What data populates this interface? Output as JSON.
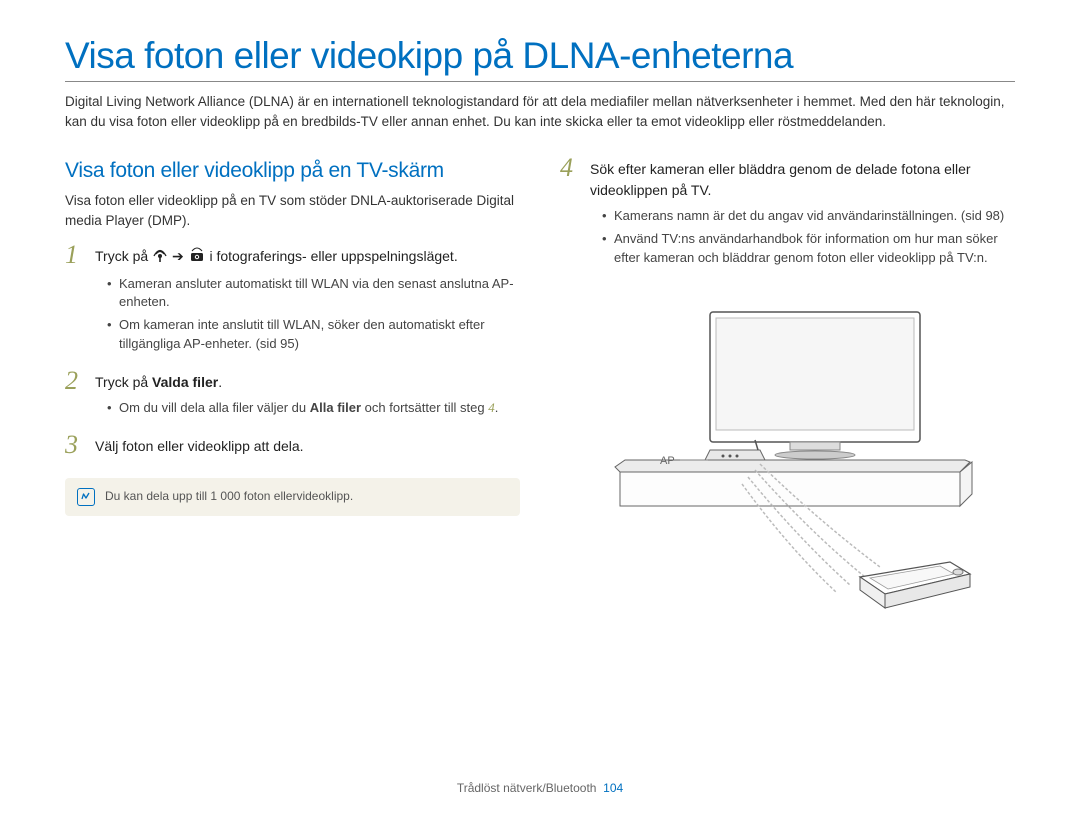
{
  "title": "Visa foton eller videokipp på DLNA-enheterna",
  "intro": "Digital Living Network Alliance (DLNA) är en internationell teknologistandard för att dela mediafiler mellan nätverksenheter i hemmet. Med den här teknologin, kan du visa foton eller videoklipp på en bredbilds-TV eller annan enhet. Du kan inte skicka eller ta emot videoklipp eller röstmeddelanden.",
  "left": {
    "heading": "Visa foton eller videoklipp på en TV-skärm",
    "subtext": "Visa foton eller videoklipp på en TV som stöder DNLA-auktoriserade Digital media Player (DMP).",
    "step1": {
      "pre": "Tryck på ",
      "post": " i fotograferings- eller uppspelningsläget.",
      "b1": "Kameran ansluter automatiskt till WLAN via den senast anslutna AP-enheten.",
      "b2": "Om kameran inte anslutit till WLAN, söker den automatiskt efter tillgängliga AP-enheter. (sid 95)"
    },
    "step2": {
      "text_a": "Tryck på ",
      "text_b": "Valda filer",
      "text_c": ".",
      "b1_a": "Om du vill dela alla filer väljer du ",
      "b1_b": "Alla filer",
      "b1_c": " och fortsätter till steg ",
      "b1_d": "4",
      "b1_e": "."
    },
    "step3": "Välj foton eller videoklipp att dela.",
    "note": "Du kan dela upp till 1 000 foton ellervideoklipp."
  },
  "right": {
    "step4": {
      "text": "Sök efter kameran eller bläddra genom de delade fotona eller videoklippen på TV.",
      "b1": "Kamerans namn är det du angav vid användarinställningen. (sid 98)",
      "b2": "Använd TV:ns användarhandbok för information om hur man söker efter kameran och bläddrar genom foton eller videoklipp på TV:n."
    },
    "ap_label": "AP"
  },
  "footer": {
    "text": "Trådlöst nätverk/Bluetooth",
    "page": "104"
  }
}
